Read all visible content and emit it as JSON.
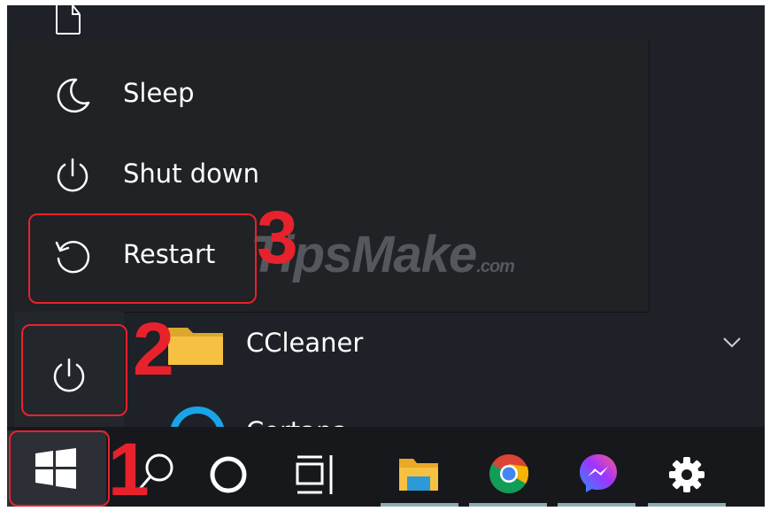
{
  "power_menu": {
    "items": [
      {
        "label": "Sleep",
        "icon": "moon-icon"
      },
      {
        "label": "Shut down",
        "icon": "power-icon"
      },
      {
        "label": "Restart",
        "icon": "restart-icon"
      }
    ]
  },
  "start_menu": {
    "apps": [
      {
        "label": "CCleaner",
        "icon": "folder-icon"
      },
      {
        "label": "Cortana",
        "icon": "cortana-ring-icon"
      }
    ]
  },
  "taskbar": {
    "icons": [
      "windows-start-icon",
      "search-icon",
      "cortana-icon",
      "task-view-icon",
      "file-explorer-icon",
      "chrome-icon",
      "messenger-icon",
      "settings-gear-icon"
    ]
  },
  "annotations": {
    "step1": "1",
    "step2": "2",
    "step3": "3"
  },
  "watermark": {
    "text": "TipsMake",
    "suffix": ".com"
  },
  "colors": {
    "annotation_red": "#e8222c",
    "menu_bg": "#202225",
    "taskbar_bg": "#16181c",
    "folder_yellow": "#f6c142",
    "cortana_blue": "#1aa3e8"
  }
}
